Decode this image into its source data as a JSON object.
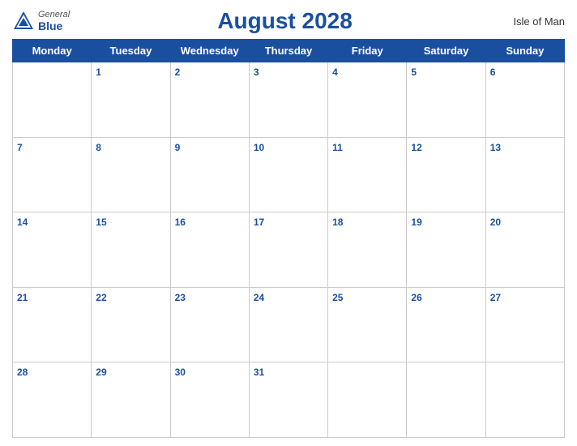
{
  "header": {
    "logo": {
      "general": "General",
      "blue": "Blue",
      "icon": "▲"
    },
    "title": "August 2028",
    "region": "Isle of Man"
  },
  "weekdays": [
    "Monday",
    "Tuesday",
    "Wednesday",
    "Thursday",
    "Friday",
    "Saturday",
    "Sunday"
  ],
  "weeks": [
    [
      "",
      "1",
      "2",
      "3",
      "4",
      "5",
      "6"
    ],
    [
      "7",
      "8",
      "9",
      "10",
      "11",
      "12",
      "13"
    ],
    [
      "14",
      "15",
      "16",
      "17",
      "18",
      "19",
      "20"
    ],
    [
      "21",
      "22",
      "23",
      "24",
      "25",
      "26",
      "27"
    ],
    [
      "28",
      "29",
      "30",
      "31",
      "",
      "",
      ""
    ]
  ]
}
